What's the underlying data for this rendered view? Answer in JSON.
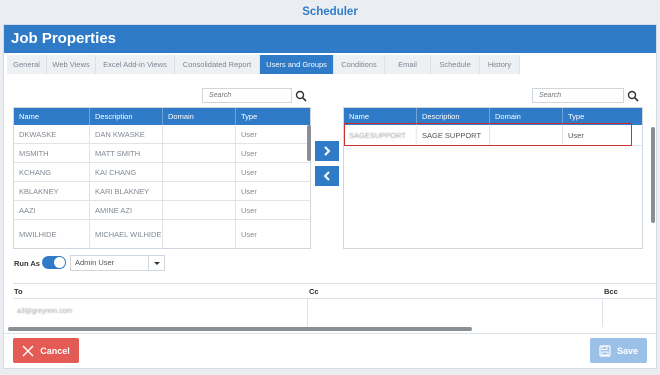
{
  "app_title": "Scheduler",
  "dialog_title": "Job Properties",
  "tabs": [
    {
      "label": "General",
      "active": false
    },
    {
      "label": "Web Views",
      "active": false
    },
    {
      "label": "Excel Add-in Views",
      "active": false
    },
    {
      "label": "Consolidated Report",
      "active": false
    },
    {
      "label": "Users and Groups",
      "active": true
    },
    {
      "label": "Conditions",
      "active": false
    },
    {
      "label": "Email",
      "active": false
    },
    {
      "label": "Schedule",
      "active": false
    },
    {
      "label": "History",
      "active": false
    }
  ],
  "search_placeholder": "Search",
  "columns": {
    "name": "Name",
    "description": "Description",
    "domain": "Domain",
    "type": "Type"
  },
  "available": [
    {
      "name": "DKWASKE",
      "description": "DAN KWASKE",
      "domain": "",
      "type": "User"
    },
    {
      "name": "MSMITH",
      "description": "MATT SMITH",
      "domain": "",
      "type": "User"
    },
    {
      "name": "KCHANG",
      "description": "KAI CHANG",
      "domain": "",
      "type": "User"
    },
    {
      "name": "KBLAKNEY",
      "description": "KARI BLAKNEY",
      "domain": "",
      "type": "User"
    },
    {
      "name": "AAZI",
      "description": "AMINE AZI",
      "domain": "",
      "type": "User"
    },
    {
      "name": "MWILHIDE",
      "description": "MICHAEL WILHIDE",
      "domain": "",
      "type": "User"
    }
  ],
  "selected": [
    {
      "name": "SAGESUPPORT",
      "description": "SAGE SUPPORT",
      "domain": "",
      "type": "User"
    }
  ],
  "run_as": {
    "label": "Run As",
    "value": "Admin User"
  },
  "recipients": {
    "to_label": "To",
    "cc_label": "Cc",
    "bcc_label": "Bcc",
    "to_value": "a3@greyrein.com"
  },
  "buttons": {
    "cancel": "Cancel",
    "save": "Save"
  },
  "colors": {
    "accent": "#2f7bc7",
    "cancel": "#e45a55",
    "save_disabled": "#9bc1e8",
    "highlight": "#c8312e"
  }
}
